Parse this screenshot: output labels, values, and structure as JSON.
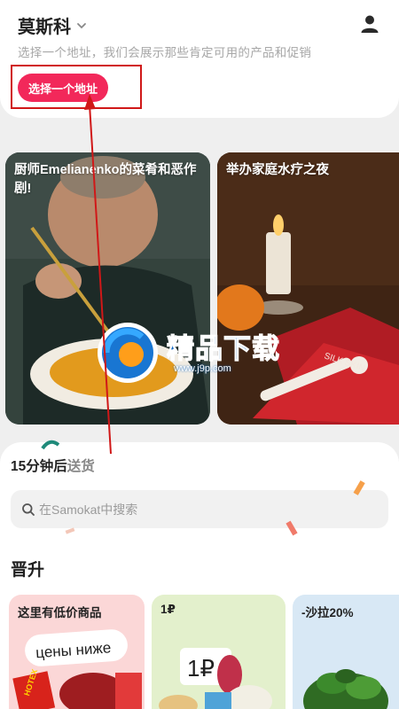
{
  "header": {
    "city": "莫斯科",
    "hint": "选择一个地址，我们会展示那些肯定可用的产品和促销",
    "address_button": "选择一个地址"
  },
  "stories": [
    {
      "title": "厨师Emelianenko的菜肴和恶作剧!"
    },
    {
      "title": "举办家庭水疗之夜",
      "product_print": "SILK SKIN"
    }
  ],
  "watermark": {
    "text": "精品下载",
    "url": "www.j9p.com"
  },
  "delivery": {
    "prefix": "15分钟后",
    "suffix": "送货"
  },
  "search": {
    "placeholder": "在Samokat中搜索"
  },
  "promos_section": {
    "title": "晋升",
    "cards": [
      {
        "title": "这里有低价商品",
        "sticker": "цены ниже",
        "package_label": "HOTEX"
      },
      {
        "title": "1₽",
        "sticker": "1₽"
      },
      {
        "title": "-沙拉20%"
      }
    ]
  },
  "icons": {
    "profile": "user-icon",
    "chevron": "chevron-down-icon",
    "search": "search-icon"
  },
  "colors": {
    "accent": "#f2285a",
    "annotation": "#d01818",
    "watermark": "#0e66c2"
  }
}
